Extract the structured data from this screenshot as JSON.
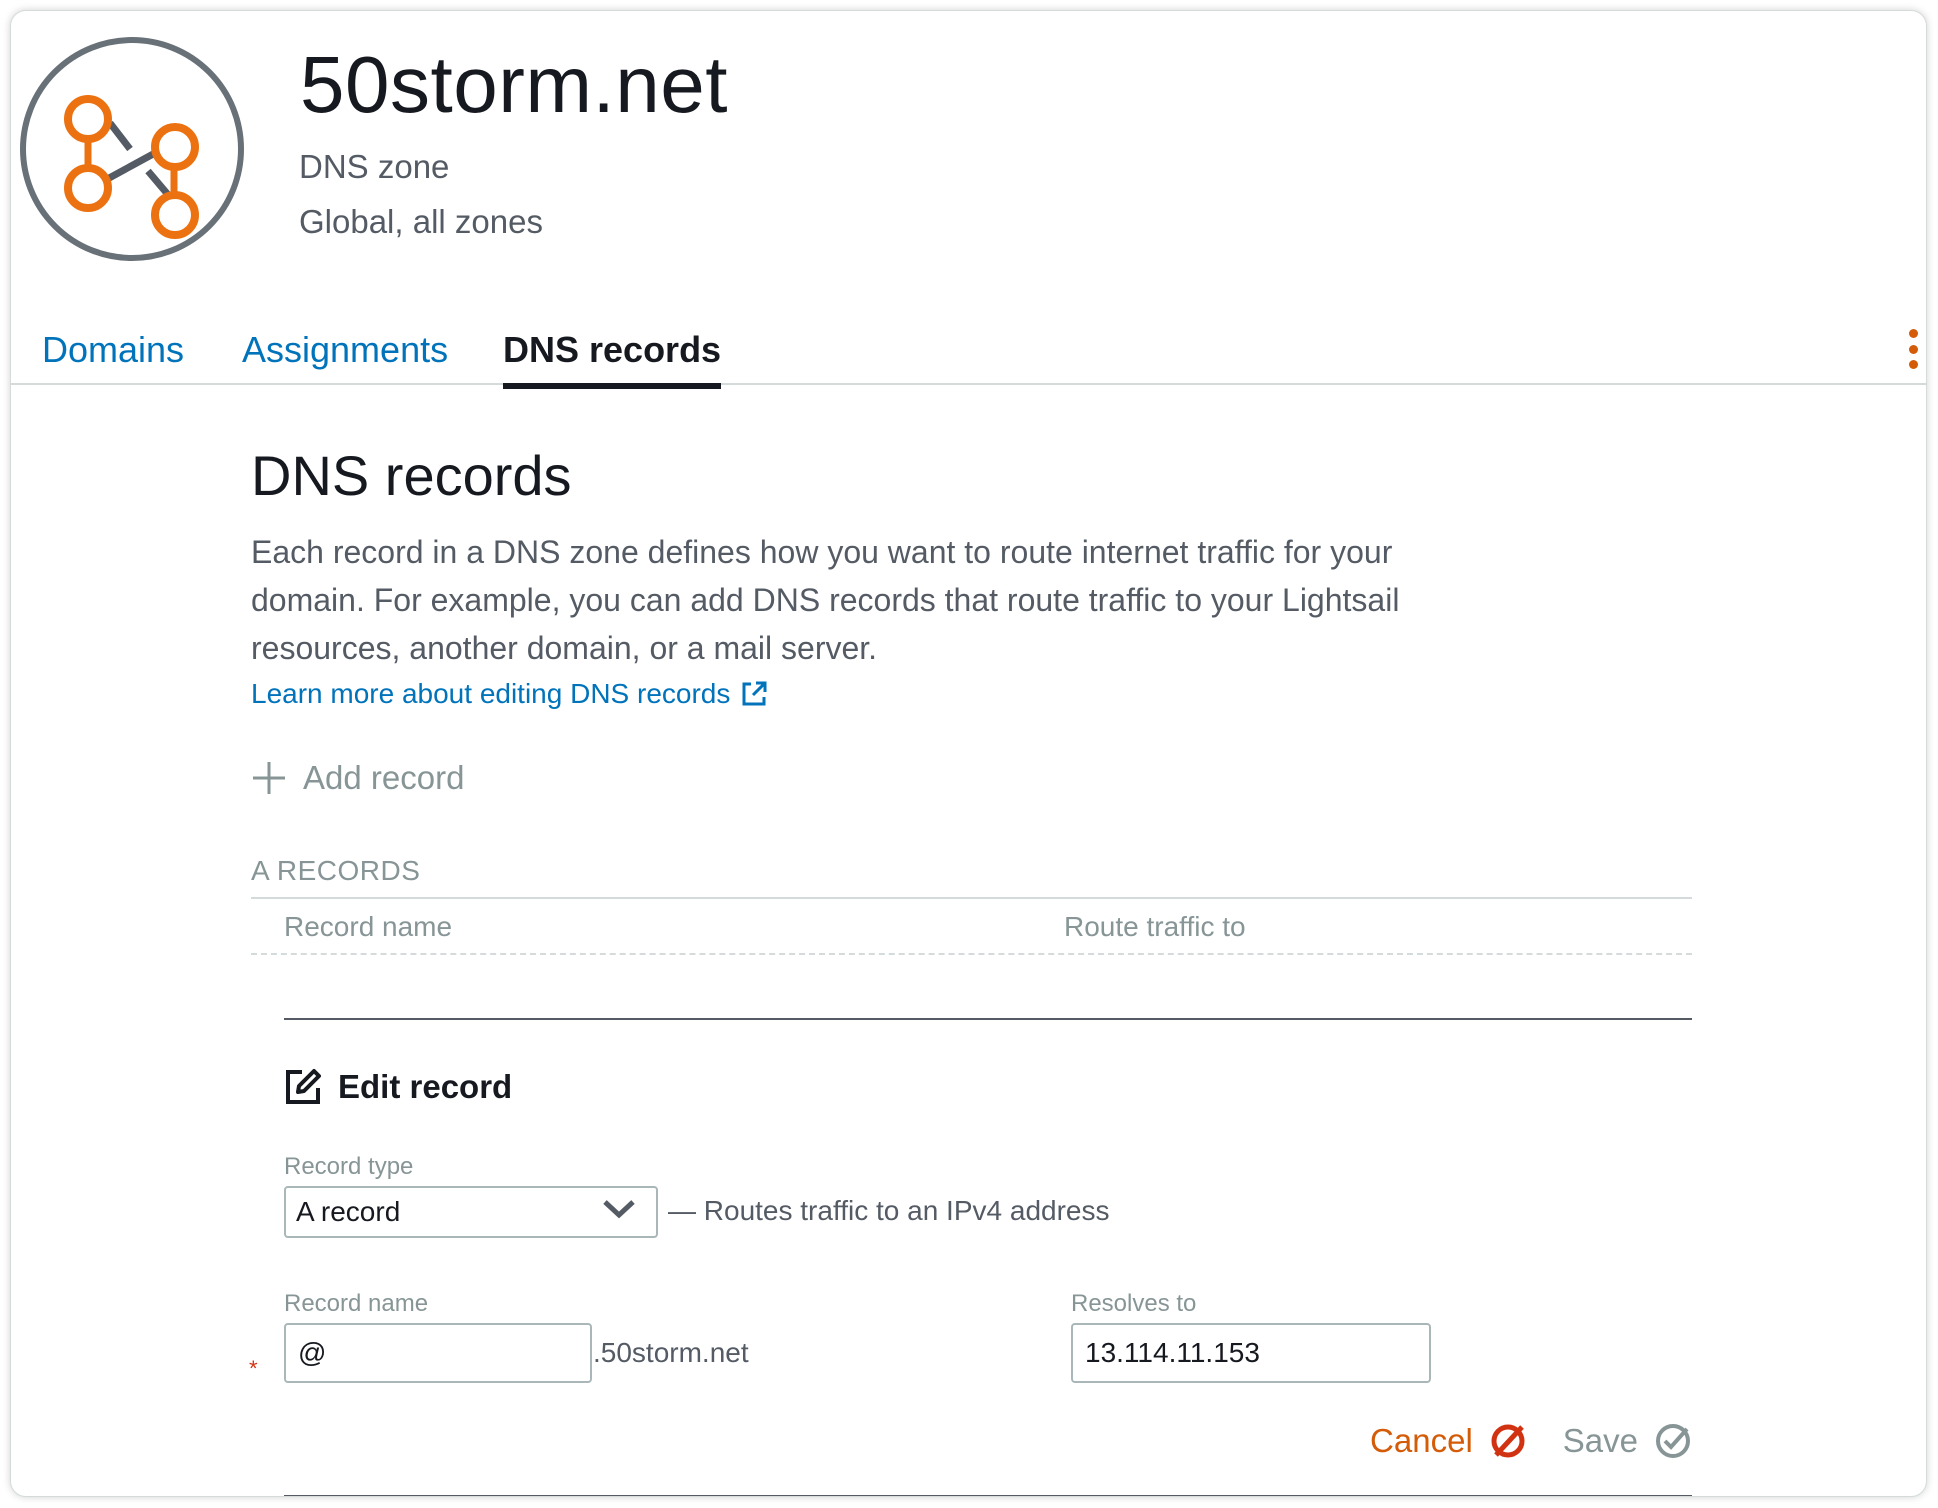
{
  "header": {
    "title": "50storm.net",
    "type": "DNS zone",
    "region": "Global, all zones",
    "logo_icon": "dns-zone-network-icon",
    "accent": "#ec7211"
  },
  "tabs": [
    {
      "label": "Domains",
      "active": false
    },
    {
      "label": "Assignments",
      "active": false
    },
    {
      "label": "DNS records",
      "active": true
    }
  ],
  "page": {
    "title": "DNS records",
    "description": "Each record in a DNS zone defines how you want to route internet traffic for your domain. For example, you can add DNS records that route traffic to your Lightsail resources, another domain, or a mail server.",
    "learn_more": "Learn more about editing DNS records",
    "add_record": "Add record"
  },
  "records_table": {
    "section_label": "A RECORDS",
    "columns": [
      "Record name",
      "Route traffic to"
    ]
  },
  "edit": {
    "heading": "Edit record",
    "record_type_label": "Record type",
    "record_type_value": "A record",
    "record_type_desc": "— Routes traffic to an IPv4 address",
    "record_name_label": "Record name",
    "record_name_value": "@",
    "record_name_suffix": ".50storm.net",
    "resolves_to_label": "Resolves to",
    "resolves_to_value": "13.114.11.153",
    "required_marker": "*",
    "cancel": "Cancel",
    "save": "Save"
  }
}
